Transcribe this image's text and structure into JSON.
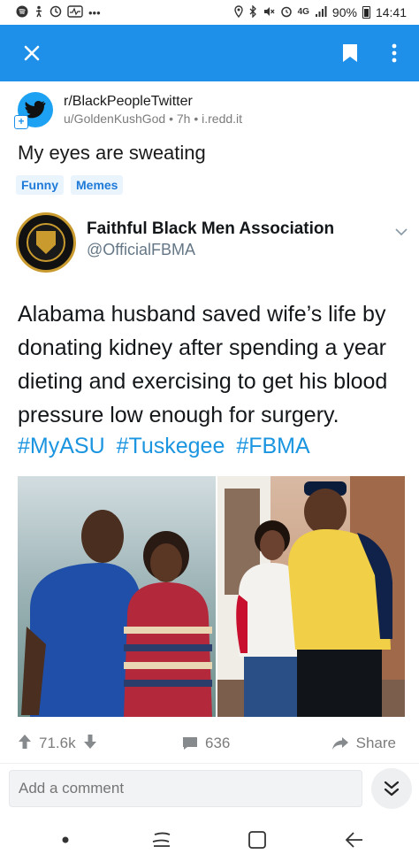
{
  "status_bar": {
    "network": "4G",
    "battery": "90%",
    "time": "14:41"
  },
  "app_bar": {
    "close_icon": "close-icon",
    "bookmark_icon": "bookmark-icon",
    "more_icon": "more-vert-icon",
    "color": "#1e90ea"
  },
  "post": {
    "subreddit": "r/BlackPeopleTwitter",
    "meta": "u/GoldenKushGod • 7h • i.redd.it",
    "title": "My eyes are sweating",
    "flairs": [
      "Funny",
      "Memes"
    ]
  },
  "tweet": {
    "name": "Faithful Black Men Association",
    "handle": "@OfficialFBMA",
    "text": "Alabama husband saved wife’s life by donating kidney after spending a year dieting and exercising to get his blood pressure low enough for surgery.",
    "hashtags": [
      "#MyASU",
      "#Tuskegee",
      "#FBMA"
    ]
  },
  "actions": {
    "votes": "71.6k",
    "comments": "636",
    "share": "Share"
  },
  "comment_bar": {
    "placeholder": "Add a comment"
  },
  "nav_bar": {
    "icons": [
      "dot-icon",
      "recent-apps-icon",
      "home-icon",
      "back-icon"
    ]
  },
  "colors": {
    "accent": "#1e90ea",
    "link": "#1b95e0"
  }
}
